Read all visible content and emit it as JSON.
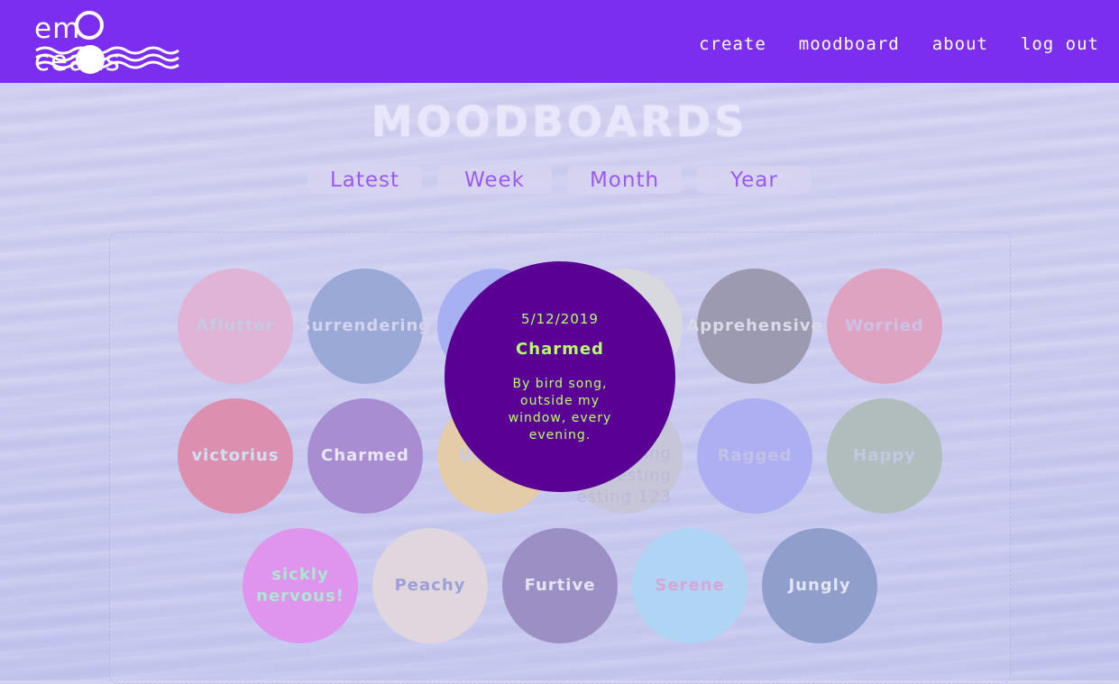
{
  "header": {
    "brand": "emOceans",
    "nav": [
      "create",
      "moodboard",
      "about",
      "log out"
    ],
    "background_color": "#7b2ef0"
  },
  "page_title": "MOODBOARDS",
  "filters": [
    "Latest",
    "Week",
    "Month",
    "Year"
  ],
  "moods": [
    {
      "label": "Aflutter",
      "color": "#dfb4d6",
      "text_color": "#c9c9e6"
    },
    {
      "label": "Surrendering",
      "color": "#9ba9d7",
      "text_color": "#d4d4ef"
    },
    {
      "label": "",
      "color": "#a8b0f4",
      "text_color": "#d4d4ef"
    },
    {
      "label": "",
      "color": "#d8d8df",
      "text_color": "#d4d4ef"
    },
    {
      "label": "Apprehensive",
      "color": "#9b9ab1",
      "text_color": "#dadae8"
    },
    {
      "label": "Worried",
      "color": "#dfa3c2",
      "text_color": "#cfc0e6"
    },
    {
      "label": "victorius",
      "color": "#dd8fb0",
      "text_color": "#cfe0f2"
    },
    {
      "label": "Charmed",
      "color": "#a88dd2",
      "text_color": "#e8e6f8"
    },
    {
      "label": "Ur",
      "color": "#e3cca7",
      "text_color": "#c9c9ee"
    },
    {
      "label": "ing\nesting\nesting 123",
      "color": "#c6c6d8",
      "text_color": "#b9b9d6"
    },
    {
      "label": "Ragged",
      "color": "#aeaef3",
      "text_color": "#c2c2e8"
    },
    {
      "label": "Happy",
      "color": "#b1bdbd",
      "text_color": "#c3c8e0"
    },
    {
      "label": "sickly\nnervous!",
      "color": "#df95ee",
      "text_color": "#aee6d2"
    },
    {
      "label": "Peachy",
      "color": "#e0d6dd",
      "text_color": "#9d9fd9"
    },
    {
      "label": "Furtive",
      "color": "#9c8fc4",
      "text_color": "#e6e4f4"
    },
    {
      "label": "Serene",
      "color": "#b0d5f4",
      "text_color": "#d8a5d9"
    },
    {
      "label": "Jungly",
      "color": "#8f9ecb",
      "text_color": "#e5e3f6"
    }
  ],
  "popup": {
    "date": "5/12/2019",
    "emotion": "Charmed",
    "note": "By bird song, outside my window, every evening.",
    "background_color": "#5a0094",
    "text_color": "#b9ff6b"
  }
}
